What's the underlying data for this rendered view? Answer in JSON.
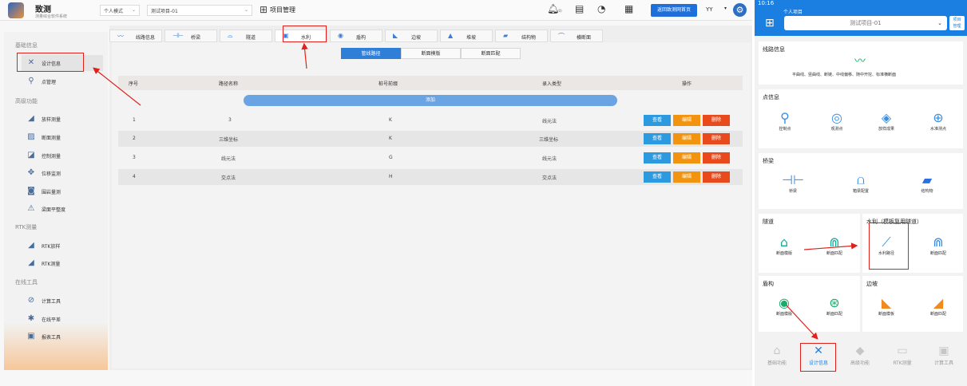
{
  "app": {
    "logo_title": "致测",
    "logo_sub": "测量综合软件系统",
    "mode_select": "个人模式",
    "project_select": "测试项目-01",
    "page_title": "项目管理",
    "bell_count": "(0)",
    "home_button": "返回致测网首页",
    "user": "YY",
    "caret": "▾"
  },
  "sidebar": {
    "groups": [
      "基础信息",
      "高级功能",
      "RTK测量",
      "在线工具"
    ],
    "items": [
      {
        "label": "设计信息",
        "icon": "wrench-icon"
      },
      {
        "label": "点管理",
        "icon": "pin-icon"
      },
      {
        "label": "放样测量",
        "icon": "stakeout-icon"
      },
      {
        "label": "断面测量",
        "icon": "section-icon"
      },
      {
        "label": "控制测量",
        "icon": "control-icon"
      },
      {
        "label": "位移监测",
        "icon": "move-icon"
      },
      {
        "label": "围岩量测",
        "icon": "tunnel-icon"
      },
      {
        "label": "梁面平整度",
        "icon": "flatness-icon"
      },
      {
        "label": "RTK放样",
        "icon": "rtk-stake-icon"
      },
      {
        "label": "RTK测量",
        "icon": "rtk-survey-icon"
      },
      {
        "label": "计算工具",
        "icon": "calc-icon"
      },
      {
        "label": "在线平差",
        "icon": "adjust-icon"
      },
      {
        "label": "报表工具",
        "icon": "report-icon"
      }
    ]
  },
  "tabs": [
    {
      "label": "线路信息",
      "icon": "〰"
    },
    {
      "label": "桥梁",
      "icon": "⊣⊢"
    },
    {
      "label": "隧道",
      "icon": "⌓"
    },
    {
      "label": "水利",
      "icon": "▣"
    },
    {
      "label": "盾构",
      "icon": "◉"
    },
    {
      "label": "边坡",
      "icon": "◣"
    },
    {
      "label": "堆坡",
      "icon": "▲"
    },
    {
      "label": "结构物",
      "icon": "▰"
    },
    {
      "label": "横断面",
      "icon": "⌒"
    }
  ],
  "segments": [
    "管线路径",
    "断面模版",
    "断面匹配"
  ],
  "table": {
    "headers": [
      "序号",
      "路径名称",
      "桩号前缀",
      "录入类型",
      "操作"
    ],
    "add_label": "添加",
    "view_label": "查看",
    "edit_label": "编辑",
    "delete_label": "删除",
    "rows": [
      [
        "1",
        "3",
        "K",
        "线元法"
      ],
      [
        "2",
        "三维坐标",
        "K",
        "三维坐标"
      ],
      [
        "3",
        "线元法",
        "G",
        "线元法"
      ],
      [
        "4",
        "交点法",
        "H",
        "交点法"
      ]
    ]
  },
  "phone": {
    "time": "10:16",
    "personal": "个人项目",
    "project": "测试项目-01",
    "caret": "⌄",
    "pm_line1": "项目",
    "pm_line2": "管理",
    "line_title": "线路信息",
    "line_desc": "平曲线、竖曲线、断链、中线偏移、随中开挖、标准横断面",
    "point_title": "点信息",
    "point_items": [
      "控制点",
      "观测点",
      "放样成果",
      "水准测点"
    ],
    "bridge_title": "桥梁",
    "bridge_items": [
      "桥梁",
      "箱梁配置",
      "结构物"
    ],
    "tunnel_title": "隧道",
    "tunnel_items": [
      "断面模版",
      "断面匹配"
    ],
    "water_title": "水利（模板复用隧道）",
    "water_items": [
      "水利路径",
      "断面匹配"
    ],
    "shield_title": "盾构",
    "shield_items": [
      "断面模版",
      "断面匹配"
    ],
    "slope_title": "边坡",
    "slope_items": [
      "断面模板",
      "断面匹配"
    ],
    "nav": [
      "基础功能",
      "设计信息",
      "高级功能",
      "RTK测量",
      "计算工具"
    ]
  },
  "colors": {
    "accent": "#1e6fd9",
    "phone_header": "#1a7fe0",
    "view": "#2d9ae0",
    "edit": "#f2940f",
    "delete": "#e84a1c",
    "annotation": "#e0201b"
  }
}
